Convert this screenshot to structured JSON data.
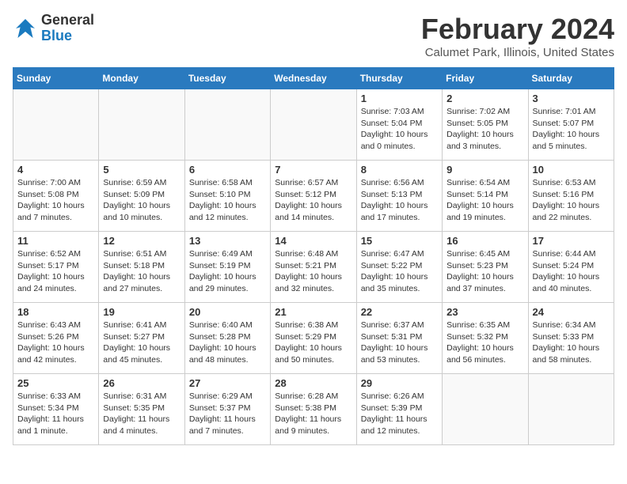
{
  "header": {
    "logo_general": "General",
    "logo_blue": "Blue",
    "title": "February 2024",
    "location": "Calumet Park, Illinois, United States"
  },
  "weekdays": [
    "Sunday",
    "Monday",
    "Tuesday",
    "Wednesday",
    "Thursday",
    "Friday",
    "Saturday"
  ],
  "weeks": [
    [
      {
        "day": "",
        "info": ""
      },
      {
        "day": "",
        "info": ""
      },
      {
        "day": "",
        "info": ""
      },
      {
        "day": "",
        "info": ""
      },
      {
        "day": "1",
        "info": "Sunrise: 7:03 AM\nSunset: 5:04 PM\nDaylight: 10 hours\nand 0 minutes."
      },
      {
        "day": "2",
        "info": "Sunrise: 7:02 AM\nSunset: 5:05 PM\nDaylight: 10 hours\nand 3 minutes."
      },
      {
        "day": "3",
        "info": "Sunrise: 7:01 AM\nSunset: 5:07 PM\nDaylight: 10 hours\nand 5 minutes."
      }
    ],
    [
      {
        "day": "4",
        "info": "Sunrise: 7:00 AM\nSunset: 5:08 PM\nDaylight: 10 hours\nand 7 minutes."
      },
      {
        "day": "5",
        "info": "Sunrise: 6:59 AM\nSunset: 5:09 PM\nDaylight: 10 hours\nand 10 minutes."
      },
      {
        "day": "6",
        "info": "Sunrise: 6:58 AM\nSunset: 5:10 PM\nDaylight: 10 hours\nand 12 minutes."
      },
      {
        "day": "7",
        "info": "Sunrise: 6:57 AM\nSunset: 5:12 PM\nDaylight: 10 hours\nand 14 minutes."
      },
      {
        "day": "8",
        "info": "Sunrise: 6:56 AM\nSunset: 5:13 PM\nDaylight: 10 hours\nand 17 minutes."
      },
      {
        "day": "9",
        "info": "Sunrise: 6:54 AM\nSunset: 5:14 PM\nDaylight: 10 hours\nand 19 minutes."
      },
      {
        "day": "10",
        "info": "Sunrise: 6:53 AM\nSunset: 5:16 PM\nDaylight: 10 hours\nand 22 minutes."
      }
    ],
    [
      {
        "day": "11",
        "info": "Sunrise: 6:52 AM\nSunset: 5:17 PM\nDaylight: 10 hours\nand 24 minutes."
      },
      {
        "day": "12",
        "info": "Sunrise: 6:51 AM\nSunset: 5:18 PM\nDaylight: 10 hours\nand 27 minutes."
      },
      {
        "day": "13",
        "info": "Sunrise: 6:49 AM\nSunset: 5:19 PM\nDaylight: 10 hours\nand 29 minutes."
      },
      {
        "day": "14",
        "info": "Sunrise: 6:48 AM\nSunset: 5:21 PM\nDaylight: 10 hours\nand 32 minutes."
      },
      {
        "day": "15",
        "info": "Sunrise: 6:47 AM\nSunset: 5:22 PM\nDaylight: 10 hours\nand 35 minutes."
      },
      {
        "day": "16",
        "info": "Sunrise: 6:45 AM\nSunset: 5:23 PM\nDaylight: 10 hours\nand 37 minutes."
      },
      {
        "day": "17",
        "info": "Sunrise: 6:44 AM\nSunset: 5:24 PM\nDaylight: 10 hours\nand 40 minutes."
      }
    ],
    [
      {
        "day": "18",
        "info": "Sunrise: 6:43 AM\nSunset: 5:26 PM\nDaylight: 10 hours\nand 42 minutes."
      },
      {
        "day": "19",
        "info": "Sunrise: 6:41 AM\nSunset: 5:27 PM\nDaylight: 10 hours\nand 45 minutes."
      },
      {
        "day": "20",
        "info": "Sunrise: 6:40 AM\nSunset: 5:28 PM\nDaylight: 10 hours\nand 48 minutes."
      },
      {
        "day": "21",
        "info": "Sunrise: 6:38 AM\nSunset: 5:29 PM\nDaylight: 10 hours\nand 50 minutes."
      },
      {
        "day": "22",
        "info": "Sunrise: 6:37 AM\nSunset: 5:31 PM\nDaylight: 10 hours\nand 53 minutes."
      },
      {
        "day": "23",
        "info": "Sunrise: 6:35 AM\nSunset: 5:32 PM\nDaylight: 10 hours\nand 56 minutes."
      },
      {
        "day": "24",
        "info": "Sunrise: 6:34 AM\nSunset: 5:33 PM\nDaylight: 10 hours\nand 58 minutes."
      }
    ],
    [
      {
        "day": "25",
        "info": "Sunrise: 6:33 AM\nSunset: 5:34 PM\nDaylight: 11 hours\nand 1 minute."
      },
      {
        "day": "26",
        "info": "Sunrise: 6:31 AM\nSunset: 5:35 PM\nDaylight: 11 hours\nand 4 minutes."
      },
      {
        "day": "27",
        "info": "Sunrise: 6:29 AM\nSunset: 5:37 PM\nDaylight: 11 hours\nand 7 minutes."
      },
      {
        "day": "28",
        "info": "Sunrise: 6:28 AM\nSunset: 5:38 PM\nDaylight: 11 hours\nand 9 minutes."
      },
      {
        "day": "29",
        "info": "Sunrise: 6:26 AM\nSunset: 5:39 PM\nDaylight: 11 hours\nand 12 minutes."
      },
      {
        "day": "",
        "info": ""
      },
      {
        "day": "",
        "info": ""
      }
    ]
  ]
}
